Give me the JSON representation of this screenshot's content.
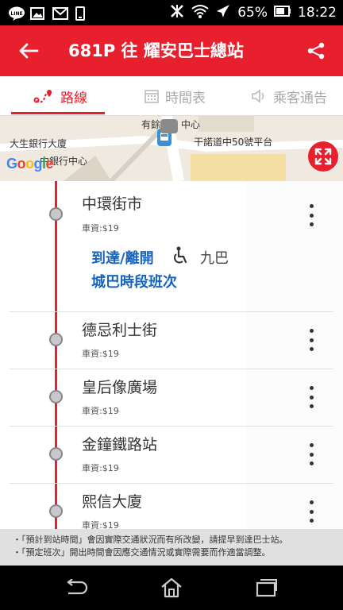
{
  "status_bar": {
    "battery": "65%",
    "time": "18:22",
    "icons": [
      "line-icon",
      "image-icon",
      "gmail-icon",
      "phone-icon",
      "mute-icon",
      "wifi-icon",
      "airplane-icon",
      "battery-icon"
    ]
  },
  "app_bar": {
    "title": "681P 往 耀安巴士總站",
    "back_icon": "back-arrow-icon",
    "share_icon": "share-icon",
    "color": "#e8202e"
  },
  "tabs": [
    {
      "label": "路線",
      "icon": "route-icon",
      "active": true
    },
    {
      "label": "時間表",
      "icon": "calendar-icon",
      "active": false
    },
    {
      "label": "乘客通告",
      "icon": "speaker-icon",
      "active": false
    }
  ],
  "map": {
    "labels": [
      "有餘",
      "中心",
      "大生銀行大廈",
      "干諾道中50號平台",
      "中銀行中心"
    ],
    "google_logo": "Google",
    "expand_icon": "expand-icon"
  },
  "stops": [
    {
      "name": "中環街市",
      "fare": "車資:$19"
    },
    {
      "name": "德忌利士街",
      "fare": "車資:$19"
    },
    {
      "name": "皇后像廣場",
      "fare": "車資:$19"
    },
    {
      "name": "金鐘鐵路站",
      "fare": "車資:$19"
    },
    {
      "name": "熙信大廈",
      "fare": "車資:$19"
    }
  ],
  "first_stop_extra": {
    "arrival_link": "到達/離開",
    "operator": "九巴",
    "schedule_link": "城巴時段班次",
    "accessibility_icon": "wheelchair-icon"
  },
  "footer_notes": [
    "・「預計到站時間」會因實際交通狀況而有所改變，請提早到達巴士站。",
    "・「預定班次」開出時間會因應交通情況或實際需要而作適當調整。"
  ],
  "nav_bar": {
    "icons": [
      "back-nav-icon",
      "home-nav-icon",
      "recents-nav-icon"
    ]
  }
}
